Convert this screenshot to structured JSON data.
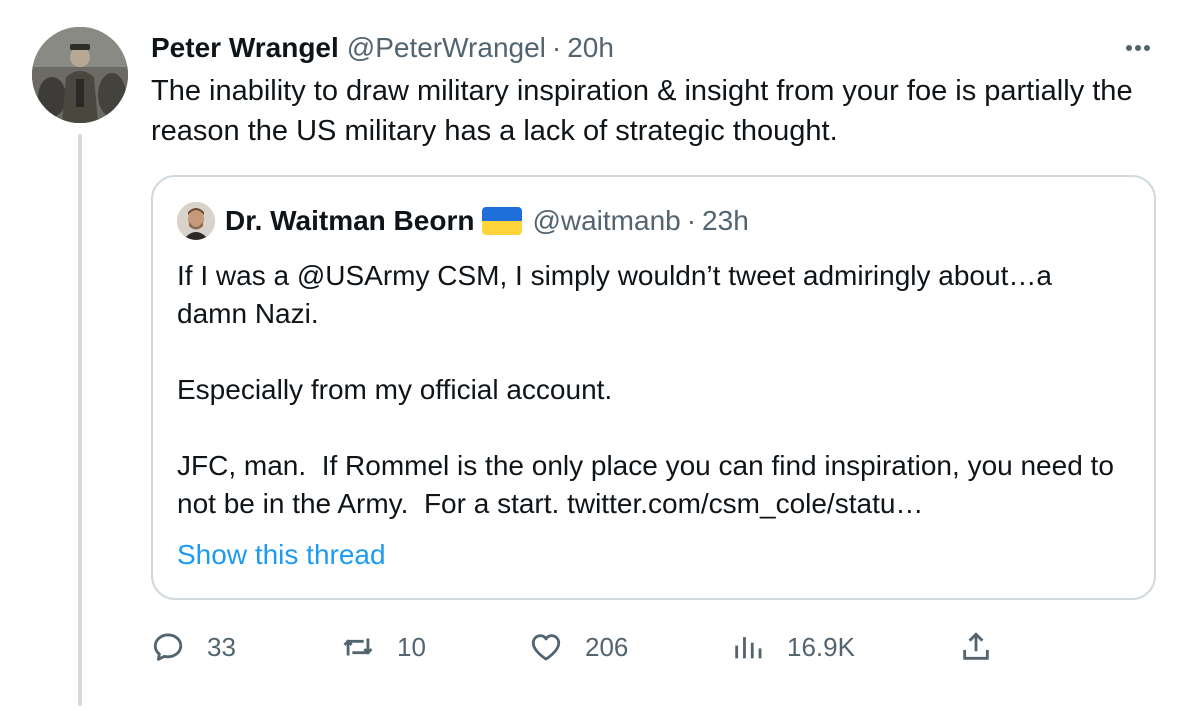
{
  "tweet": {
    "author_name": "Peter Wrangel",
    "author_handle": "@PeterWrangel",
    "separator": "·",
    "time": "20h",
    "text": "The inability to draw military inspiration & insight from your foe is partially the reason the US military has a lack of strategic thought."
  },
  "quote": {
    "author_name": "Dr. Waitman Beorn",
    "author_handle": "@waitmanb",
    "separator": "·",
    "time": "23h",
    "text": "If I was a @USArmy CSM, I simply wouldn’t tweet admiringly about…a damn Nazi.\n\nEspecially from my official account.\n\nJFC, man.  If Rommel is the only place you can find inspiration, you need to not be in the Army.  For a start. twitter.com/csm_cole/statu…",
    "show_thread": "Show this thread",
    "flag_colors": [
      "#1e6fd9",
      "#ffd43b"
    ]
  },
  "actions": {
    "replies": "33",
    "retweets": "10",
    "likes": "206",
    "views": "16.9K"
  },
  "icons": [
    "more-icon",
    "reply-icon",
    "retweet-icon",
    "like-icon",
    "views-icon",
    "share-icon"
  ],
  "colors": {
    "text": "#0f1419",
    "secondary": "#536471",
    "link": "#1d9bf0",
    "border": "#cfd9de"
  }
}
